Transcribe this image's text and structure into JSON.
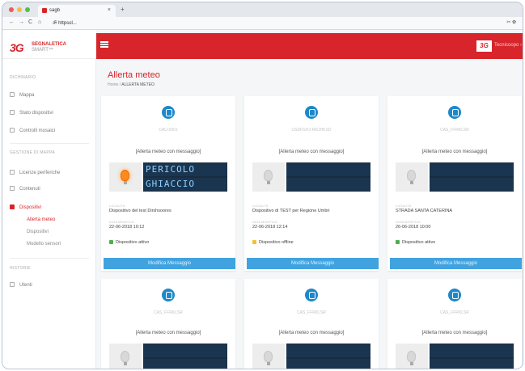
{
  "browser": {
    "tab_title": "sagb",
    "url": "ॐ httpsol...",
    "new_tab": "+",
    "tab_close": "×",
    "nav": [
      "←",
      "→",
      "C",
      "⌂"
    ],
    "tools": "✂ ✿"
  },
  "brand": {
    "mark": "3G",
    "name": "SEGNALETICA",
    "sub": "SMART™"
  },
  "header": {
    "user_logo": "3G",
    "user_name": "Tecnicoopo ›"
  },
  "sidebar": {
    "sections": [
      "DICHINARIO",
      "GESTIONE DI MAPPA",
      "HISTORIE"
    ],
    "items": [
      {
        "label": "Mappa"
      },
      {
        "label": "Stato dispositivi"
      },
      {
        "label": "Controlli mosaici"
      },
      {
        "label": "Licenze periferiche"
      },
      {
        "label": "Contenuti"
      },
      {
        "label": "Dispositivi"
      },
      {
        "label": "Utenti"
      }
    ],
    "sub_items": [
      {
        "label": "Allerta meteo"
      },
      {
        "label": "Dispositivi"
      },
      {
        "label": "Modello sensori"
      }
    ]
  },
  "page": {
    "title": "Allerta meteo",
    "crumb_home": "Home",
    "crumb_sep": "/",
    "crumb_current": "ALLERTA METEO"
  },
  "cards": [
    {
      "code": "CAU-0001",
      "message": "[Allerta meteo con messaggio]",
      "light_on": true,
      "led": [
        "PERICOLO",
        "GHIACCIO"
      ],
      "loc_label": "LOCALITÀ",
      "loc": "Dispositivo del test Dirshsoores",
      "date_label": "DATA MODIFICA",
      "date": "22-06-2018 10:12",
      "status": "Dispositivo attivo",
      "status_color": "#4caf50",
      "button": "Modifica Messaggio"
    },
    {
      "code": "USDFGHJ-RRJHKSD",
      "message": "[Allerta meteo con messaggio]",
      "light_on": false,
      "led": [
        "",
        ""
      ],
      "loc_label": "LOCALITÀ",
      "loc": "Dispositivo di TEST per Regione Umbri",
      "date_label": "DATA MODIFICA",
      "date": "22-06-2018 12:14",
      "status": "Dispositivo offline",
      "status_color": "#f2c230",
      "button": "Modifica Messaggio"
    },
    {
      "code": "CAS_FFRKLSR",
      "message": "[Allerta meteo con messaggio]",
      "light_on": false,
      "led": [
        "",
        ""
      ],
      "loc_label": "LOCALITÀ",
      "loc": "STRADA SANTA CATERINA",
      "date_label": "DATA MODIFICA",
      "date": "26-06-2018 10:00",
      "status": "Dispositivo attivo",
      "status_color": "#4caf50",
      "button": "Modifica Messaggio"
    },
    {
      "code": "CAS_FFRKLSR",
      "message": "[Allerta meteo con messaggio]",
      "light_on": false,
      "led": [
        "",
        ""
      ]
    },
    {
      "code": "CAS_FFRKLSR",
      "message": "[Allerta meteo con messaggio]",
      "light_on": false,
      "led": [
        "",
        ""
      ]
    },
    {
      "code": "CAS_FFRKLSR",
      "message": "[Allerta meteo con messaggio]",
      "light_on": false,
      "led": [
        "",
        ""
      ]
    }
  ],
  "colors": {
    "brand_red": "#d7252b",
    "accent_blue": "#40a3e0",
    "icon_blue": "#1e88c9"
  }
}
